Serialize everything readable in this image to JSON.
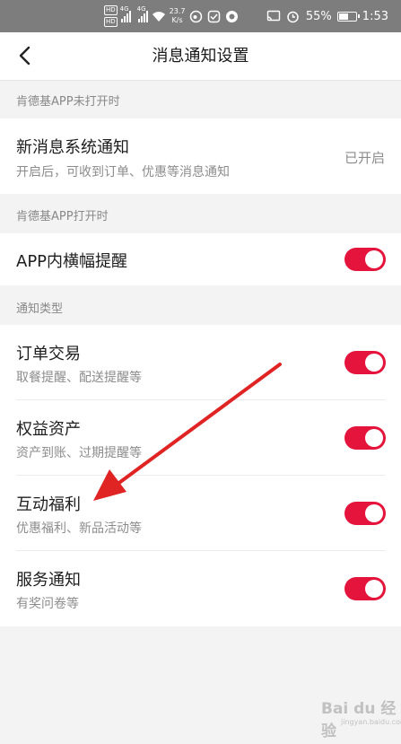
{
  "status_bar": {
    "hd1": "HD",
    "hd2": "HD",
    "net1": "4G",
    "net2": "4G",
    "speed_value": "23.7",
    "speed_unit": "K/s",
    "battery": "55%",
    "time": "1:53"
  },
  "nav": {
    "title": "消息通知设置"
  },
  "sections": {
    "closed_label": "肯德基APP未打开时",
    "open_label": "肯德基APP打开时",
    "types_label": "通知类型"
  },
  "system_notify": {
    "title": "新消息系统通知",
    "subtitle": "开启后，可收到订单、优惠等消息通知",
    "value": "已开启"
  },
  "banner": {
    "title": "APP内横幅提醒",
    "enabled": true
  },
  "types": [
    {
      "title": "订单交易",
      "subtitle": "取餐提醒、配送提醒等",
      "enabled": true
    },
    {
      "title": "权益资产",
      "subtitle": "资产到账、过期提醒等",
      "enabled": true
    },
    {
      "title": "互动福利",
      "subtitle": "优惠福利、新品活动等",
      "enabled": true
    },
    {
      "title": "服务通知",
      "subtitle": "有奖问卷等",
      "enabled": true
    }
  ],
  "watermark": {
    "brand": "Bai du 经验",
    "url": "jingyan.baidu.com"
  },
  "colors": {
    "accent": "#e5143c",
    "status_bar": "#7d7d7d",
    "annotation_arrow": "#e02424"
  }
}
